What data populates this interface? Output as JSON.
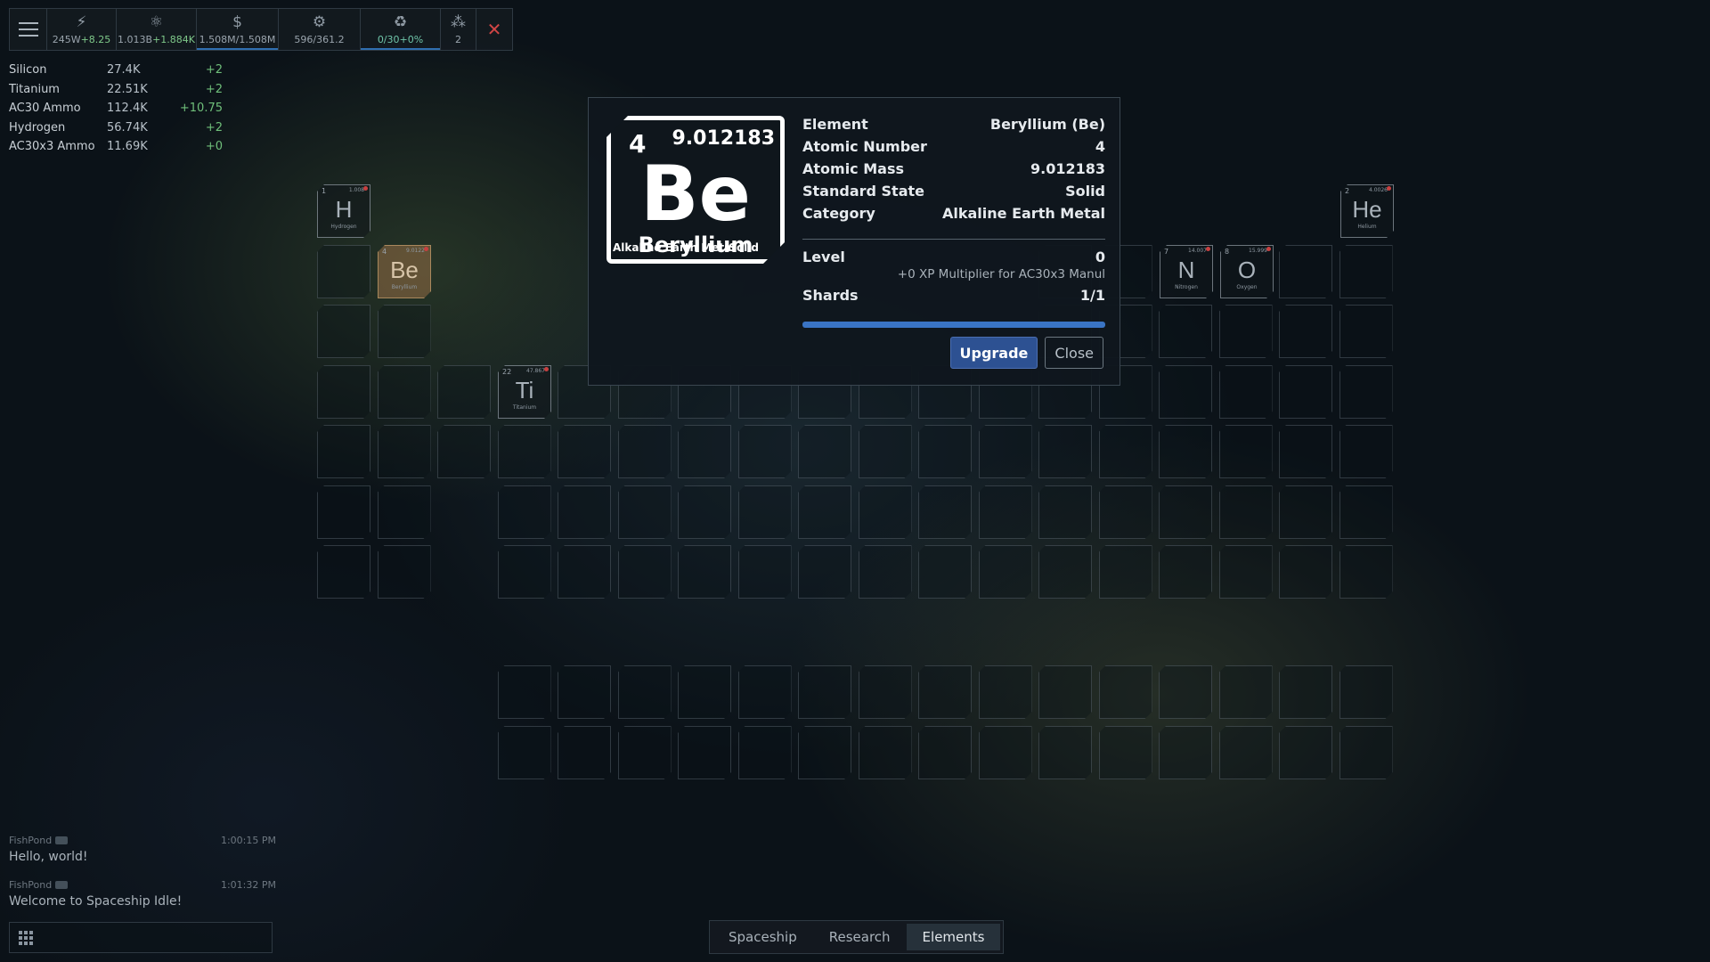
{
  "toolbar": {
    "menu_icon": "hamburger-icon",
    "items": [
      {
        "icon": "lightning-icon",
        "value": "245W",
        "delta": "+8.25"
      },
      {
        "icon": "atom-icon",
        "value": "1.013B",
        "delta": "+1.884K"
      },
      {
        "icon": "dollar-icon",
        "value": "1.508M/1.508M"
      },
      {
        "icon": "gear-icon",
        "value": "596/361.2"
      },
      {
        "icon": "recycle-icon",
        "value": "0/30+0%"
      },
      {
        "icon": "crew-icon",
        "value": "2"
      },
      {
        "icon": "crossed-out-icon"
      }
    ]
  },
  "resources": [
    {
      "name": "Silicon",
      "amount": "27.4K",
      "delta": "+2"
    },
    {
      "name": "Titanium",
      "amount": "22.51K",
      "delta": "+2"
    },
    {
      "name": "AC30 Ammo",
      "amount": "112.4K",
      "delta": "+10.75"
    },
    {
      "name": "Hydrogen",
      "amount": "56.74K",
      "delta": "+2"
    },
    {
      "name": "AC30x3 Ammo",
      "amount": "11.69K",
      "delta": "+0"
    }
  ],
  "elements": {
    "h": {
      "num": "1",
      "sym": "H",
      "mass": "1.008",
      "name": "Hydrogen"
    },
    "he": {
      "num": "2",
      "sym": "He",
      "mass": "4.0026",
      "name": "Helium"
    },
    "be": {
      "num": "4",
      "sym": "Be",
      "mass": "9.0122",
      "name": "Beryllium"
    },
    "n": {
      "num": "7",
      "sym": "N",
      "mass": "14.007",
      "name": "Nitrogen"
    },
    "o": {
      "num": "8",
      "sym": "O",
      "mass": "15.999",
      "name": "Oxygen"
    },
    "ti": {
      "num": "22",
      "sym": "Ti",
      "mass": "47.867",
      "name": "Titanium"
    }
  },
  "modal": {
    "card": {
      "number": "4",
      "mass": "9.012183",
      "symbol": "Be",
      "name": "Beryllium",
      "category": "Alkaline Earth Metal",
      "state": "Solid"
    },
    "rows": [
      {
        "label": "Element",
        "value": "Beryllium (Be)"
      },
      {
        "label": "Atomic Number",
        "value": "4"
      },
      {
        "label": "Atomic Mass",
        "value": "9.012183"
      },
      {
        "label": "Standard State",
        "value": "Solid"
      },
      {
        "label": "Category",
        "value": "Alkaline Earth Metal"
      }
    ],
    "level_label": "Level",
    "level_value": "0",
    "multiplier": "+0 XP Multiplier for AC30x3 Manul",
    "shards_label": "Shards",
    "shards_value": "1/1",
    "shards_progress": 1.0,
    "upgrade_label": "Upgrade",
    "close_label": "Close"
  },
  "chat": {
    "messages": [
      {
        "user": "FishPond",
        "time": "1:00:15 PM",
        "text": "Hello, world!"
      },
      {
        "user": "FishPond",
        "time": "1:01:32 PM",
        "text": "Welcome to Spaceship Idle!"
      }
    ],
    "menu_icon": "grid-icon"
  },
  "tabs": [
    {
      "label": "Spaceship",
      "active": false
    },
    {
      "label": "Research",
      "active": false
    },
    {
      "label": "Elements",
      "active": true
    }
  ]
}
